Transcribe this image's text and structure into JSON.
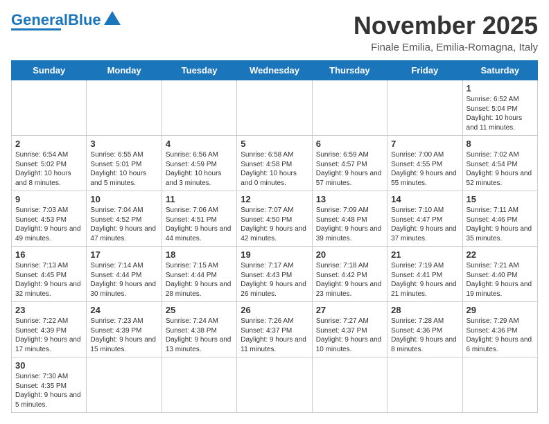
{
  "header": {
    "logo_general": "General",
    "logo_blue": "Blue",
    "month_title": "November 2025",
    "subtitle": "Finale Emilia, Emilia-Romagna, Italy"
  },
  "days_of_week": [
    "Sunday",
    "Monday",
    "Tuesday",
    "Wednesday",
    "Thursday",
    "Friday",
    "Saturday"
  ],
  "weeks": [
    [
      {
        "day": "",
        "info": ""
      },
      {
        "day": "",
        "info": ""
      },
      {
        "day": "",
        "info": ""
      },
      {
        "day": "",
        "info": ""
      },
      {
        "day": "",
        "info": ""
      },
      {
        "day": "",
        "info": ""
      },
      {
        "day": "1",
        "info": "Sunrise: 6:52 AM\nSunset: 5:04 PM\nDaylight: 10 hours and 11 minutes."
      }
    ],
    [
      {
        "day": "2",
        "info": "Sunrise: 6:54 AM\nSunset: 5:02 PM\nDaylight: 10 hours and 8 minutes."
      },
      {
        "day": "3",
        "info": "Sunrise: 6:55 AM\nSunset: 5:01 PM\nDaylight: 10 hours and 5 minutes."
      },
      {
        "day": "4",
        "info": "Sunrise: 6:56 AM\nSunset: 4:59 PM\nDaylight: 10 hours and 3 minutes."
      },
      {
        "day": "5",
        "info": "Sunrise: 6:58 AM\nSunset: 4:58 PM\nDaylight: 10 hours and 0 minutes."
      },
      {
        "day": "6",
        "info": "Sunrise: 6:59 AM\nSunset: 4:57 PM\nDaylight: 9 hours and 57 minutes."
      },
      {
        "day": "7",
        "info": "Sunrise: 7:00 AM\nSunset: 4:55 PM\nDaylight: 9 hours and 55 minutes."
      },
      {
        "day": "8",
        "info": "Sunrise: 7:02 AM\nSunset: 4:54 PM\nDaylight: 9 hours and 52 minutes."
      }
    ],
    [
      {
        "day": "9",
        "info": "Sunrise: 7:03 AM\nSunset: 4:53 PM\nDaylight: 9 hours and 49 minutes."
      },
      {
        "day": "10",
        "info": "Sunrise: 7:04 AM\nSunset: 4:52 PM\nDaylight: 9 hours and 47 minutes."
      },
      {
        "day": "11",
        "info": "Sunrise: 7:06 AM\nSunset: 4:51 PM\nDaylight: 9 hours and 44 minutes."
      },
      {
        "day": "12",
        "info": "Sunrise: 7:07 AM\nSunset: 4:50 PM\nDaylight: 9 hours and 42 minutes."
      },
      {
        "day": "13",
        "info": "Sunrise: 7:09 AM\nSunset: 4:48 PM\nDaylight: 9 hours and 39 minutes."
      },
      {
        "day": "14",
        "info": "Sunrise: 7:10 AM\nSunset: 4:47 PM\nDaylight: 9 hours and 37 minutes."
      },
      {
        "day": "15",
        "info": "Sunrise: 7:11 AM\nSunset: 4:46 PM\nDaylight: 9 hours and 35 minutes."
      }
    ],
    [
      {
        "day": "16",
        "info": "Sunrise: 7:13 AM\nSunset: 4:45 PM\nDaylight: 9 hours and 32 minutes."
      },
      {
        "day": "17",
        "info": "Sunrise: 7:14 AM\nSunset: 4:44 PM\nDaylight: 9 hours and 30 minutes."
      },
      {
        "day": "18",
        "info": "Sunrise: 7:15 AM\nSunset: 4:44 PM\nDaylight: 9 hours and 28 minutes."
      },
      {
        "day": "19",
        "info": "Sunrise: 7:17 AM\nSunset: 4:43 PM\nDaylight: 9 hours and 26 minutes."
      },
      {
        "day": "20",
        "info": "Sunrise: 7:18 AM\nSunset: 4:42 PM\nDaylight: 9 hours and 23 minutes."
      },
      {
        "day": "21",
        "info": "Sunrise: 7:19 AM\nSunset: 4:41 PM\nDaylight: 9 hours and 21 minutes."
      },
      {
        "day": "22",
        "info": "Sunrise: 7:21 AM\nSunset: 4:40 PM\nDaylight: 9 hours and 19 minutes."
      }
    ],
    [
      {
        "day": "23",
        "info": "Sunrise: 7:22 AM\nSunset: 4:39 PM\nDaylight: 9 hours and 17 minutes."
      },
      {
        "day": "24",
        "info": "Sunrise: 7:23 AM\nSunset: 4:39 PM\nDaylight: 9 hours and 15 minutes."
      },
      {
        "day": "25",
        "info": "Sunrise: 7:24 AM\nSunset: 4:38 PM\nDaylight: 9 hours and 13 minutes."
      },
      {
        "day": "26",
        "info": "Sunrise: 7:26 AM\nSunset: 4:37 PM\nDaylight: 9 hours and 11 minutes."
      },
      {
        "day": "27",
        "info": "Sunrise: 7:27 AM\nSunset: 4:37 PM\nDaylight: 9 hours and 10 minutes."
      },
      {
        "day": "28",
        "info": "Sunrise: 7:28 AM\nSunset: 4:36 PM\nDaylight: 9 hours and 8 minutes."
      },
      {
        "day": "29",
        "info": "Sunrise: 7:29 AM\nSunset: 4:36 PM\nDaylight: 9 hours and 6 minutes."
      }
    ],
    [
      {
        "day": "30",
        "info": "Sunrise: 7:30 AM\nSunset: 4:35 PM\nDaylight: 9 hours and 5 minutes."
      },
      {
        "day": "",
        "info": ""
      },
      {
        "day": "",
        "info": ""
      },
      {
        "day": "",
        "info": ""
      },
      {
        "day": "",
        "info": ""
      },
      {
        "day": "",
        "info": ""
      },
      {
        "day": "",
        "info": ""
      }
    ]
  ]
}
